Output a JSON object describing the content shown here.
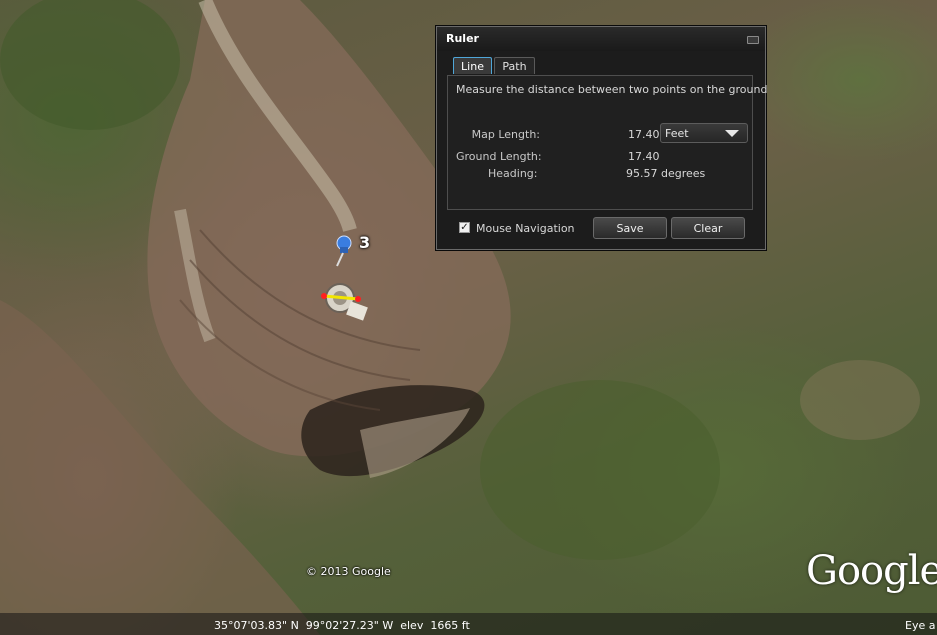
{
  "map": {
    "copyright": "© 2013 Google",
    "logo": "Google",
    "placemark_label": "3",
    "status": {
      "coordinates": "35°07'03.83\" N  99°02'27.23\" W  elev  1665 ft",
      "eye_alt": "Eye a"
    }
  },
  "ruler": {
    "title": "Ruler",
    "tabs": [
      {
        "label": "Line",
        "active": true
      },
      {
        "label": "Path",
        "active": false
      }
    ],
    "description": "Measure the distance between two points on the ground",
    "map_length": {
      "label": "Map Length:",
      "value": "17.40"
    },
    "unit_select": {
      "selected": "Feet"
    },
    "ground_length": {
      "label": "Ground Length:",
      "value": "17.40"
    },
    "heading": {
      "label": "Heading:",
      "value": "95.57 degrees"
    },
    "mouse_navigation": {
      "label": "Mouse Navigation",
      "checked": true,
      "check_glyph": "✓"
    },
    "buttons": {
      "save": "Save",
      "clear": "Clear"
    }
  },
  "colors": {
    "tab_active_border": "#4fa6d8",
    "measure_line": "#f2e600",
    "measure_endpoints": "#ff2020",
    "pushpin": "#3a7de0"
  },
  "icons": {
    "pushpin": "pushpin-icon",
    "minimize": "minimize-icon",
    "dropdown": "chevron-down-icon"
  }
}
